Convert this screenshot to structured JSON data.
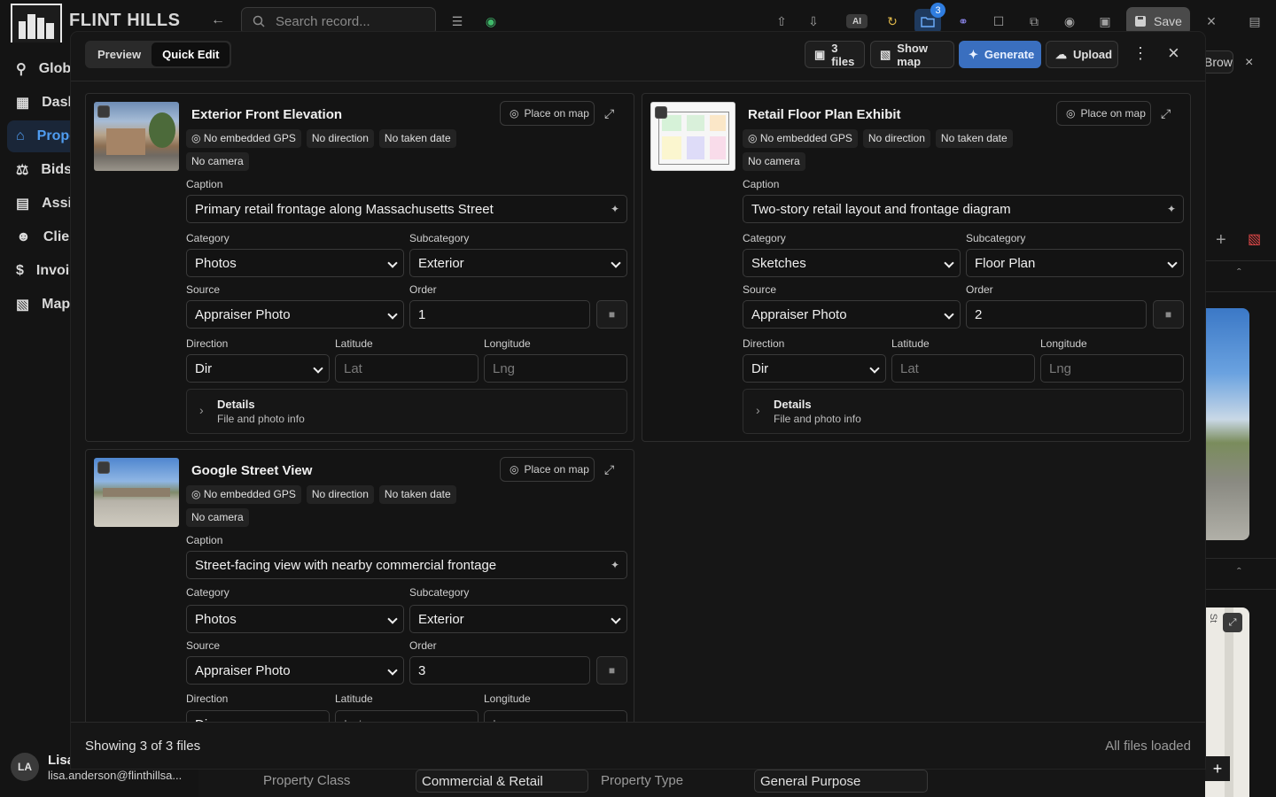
{
  "app": {
    "brand": "FLINT HILLS",
    "notification_count": "3"
  },
  "topbar": {
    "search_placeholder": "Search record...",
    "ai_label": "AI",
    "save_label": "Save"
  },
  "sidebar": {
    "items": [
      {
        "label": "Global Search",
        "icon": "search-icon"
      },
      {
        "label": "Dashboard",
        "icon": "grid-icon"
      },
      {
        "label": "Properties",
        "icon": "house-icon",
        "active": true
      },
      {
        "label": "Bids",
        "icon": "scale-icon"
      },
      {
        "label": "Assignments",
        "icon": "document-icon"
      },
      {
        "label": "Clients",
        "icon": "users-icon"
      },
      {
        "label": "Invoices",
        "icon": "dollar-icon"
      },
      {
        "label": "Map",
        "icon": "map-icon"
      }
    ]
  },
  "user": {
    "initials": "LA",
    "name": "Lisa",
    "email": "lisa.anderson@flinthillsa..."
  },
  "background": {
    "browse_label": "Browse",
    "property_class_label": "Property Class",
    "property_class_value": "Commercial & Retail",
    "property_type_label": "Property Type",
    "property_type_value": "General Purpose"
  },
  "modal": {
    "tabs": [
      "Preview",
      "Quick Edit"
    ],
    "active_tab": "Quick Edit",
    "files_label": "3 files",
    "show_map_label": "Show map",
    "generate_label": "Generate",
    "upload_label": "Upload",
    "footer_count": "Showing 3 of 3 files",
    "footer_status": "All files loaded",
    "colors": {
      "primary": "#3a6fbf",
      "active_nav": "#4f9cf0",
      "badge": "#2f7de0"
    }
  },
  "labels": {
    "caption": "Caption",
    "category": "Category",
    "subcategory": "Subcategory",
    "source": "Source",
    "order": "Order",
    "direction": "Direction",
    "latitude": "Latitude",
    "longitude": "Longitude",
    "place_on_map": "Place on map",
    "details": "Details",
    "details_sub": "File and photo info",
    "dir_placeholder": "Dir",
    "lat_placeholder": "Lat",
    "lng_placeholder": "Lng"
  },
  "files": [
    {
      "title": "Exterior Front Elevation",
      "chips": [
        "No embedded GPS",
        "No direction",
        "No taken date",
        "No camera"
      ],
      "caption": "Primary retail frontage along Massachusetts Street",
      "category": "Photos",
      "subcategory": "Exterior",
      "source": "Appraiser Photo",
      "order": "1",
      "direction": "Dir",
      "latitude": "",
      "longitude": ""
    },
    {
      "title": "Retail Floor Plan Exhibit",
      "chips": [
        "No embedded GPS",
        "No direction",
        "No taken date",
        "No camera"
      ],
      "caption": "Two-story retail layout and frontage diagram",
      "category": "Sketches",
      "subcategory": "Floor Plan",
      "source": "Appraiser Photo",
      "order": "2",
      "direction": "Dir",
      "latitude": "",
      "longitude": ""
    },
    {
      "title": "Google Street View",
      "chips": [
        "No embedded GPS",
        "No direction",
        "No taken date",
        "No camera"
      ],
      "caption": "Street-facing view with nearby commercial frontage",
      "category": "Photos",
      "subcategory": "Exterior",
      "source": "Appraiser Photo",
      "order": "3",
      "direction": "Dir",
      "latitude": "",
      "longitude": ""
    }
  ]
}
